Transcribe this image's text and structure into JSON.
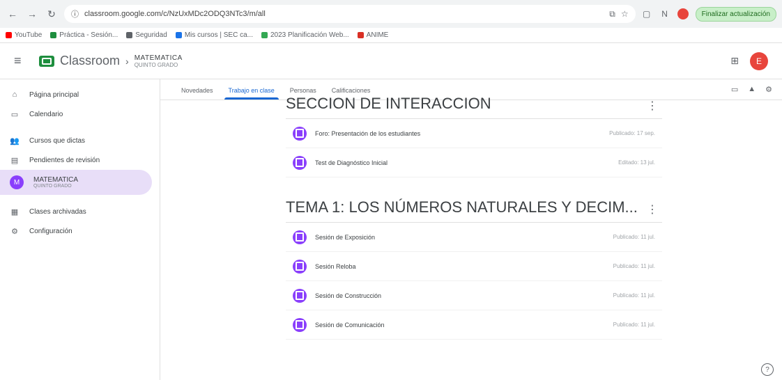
{
  "browser": {
    "url": "classroom.google.com/c/NzUxMDc2ODQ3NTc3/m/all",
    "finish_label": "Finalizar actualización",
    "profile_initial": "N",
    "bookmarks": [
      {
        "label": "YouTube",
        "color": "#ff0000"
      },
      {
        "label": "Práctica - Sesión...",
        "color": "#1e8e3e"
      },
      {
        "label": "Seguridad",
        "color": "#5f6368"
      },
      {
        "label": "Mis cursos | SEC ca...",
        "color": "#1a73e8"
      },
      {
        "label": "2023 Planificación Web...",
        "color": "#34a853"
      },
      {
        "label": "ANIME",
        "color": "#d93025"
      }
    ]
  },
  "header": {
    "app_name": "Classroom",
    "course_title": "MATEMATICA",
    "course_subtitle": "QUINTO GRADO",
    "avatar_initial": "E"
  },
  "sidebar": {
    "items": [
      {
        "label": "Página principal",
        "icon": "home-icon",
        "glyph": "⌂"
      },
      {
        "label": "Calendario",
        "icon": "calendar-icon",
        "glyph": "▭"
      },
      {
        "label": "Cursos que dictas",
        "icon": "people-icon",
        "glyph": "👥"
      },
      {
        "label": "Pendientes de revisión",
        "icon": "todo-icon",
        "glyph": "▤"
      },
      {
        "label": "MATEMATICA",
        "sub": "QUINTO GRADO",
        "icon": "course-icon",
        "initial": "M"
      },
      {
        "label": "Clases archivadas",
        "icon": "archive-icon",
        "glyph": "▦"
      },
      {
        "label": "Configuración",
        "icon": "gear-icon",
        "glyph": "⚙"
      }
    ]
  },
  "tabs": [
    "Novedades",
    "Trabajo en clase",
    "Personas",
    "Calificaciones"
  ],
  "sections": [
    {
      "title": "SECCION DE INTERACCION",
      "items": [
        {
          "title": "Foro: Presentación de los estudiantes",
          "date": "Publicado: 17 sep."
        },
        {
          "title": "Test de Diagnóstico Inicial",
          "date": "Editado: 13 jul."
        }
      ]
    },
    {
      "title": "TEMA 1: LOS NÚMEROS NATURALES Y DECIM...",
      "items": [
        {
          "title": "Sesión de Exposición",
          "date": "Publicado: 11 jul."
        },
        {
          "title": "Sesión Reloba",
          "date": "Publicado: 11 jul."
        },
        {
          "title": "Sesión de Construcción",
          "date": "Publicado: 11 jul."
        },
        {
          "title": "Sesión de Comunicación",
          "date": "Publicado: 11 jul."
        }
      ]
    }
  ],
  "help_glyph": "?"
}
